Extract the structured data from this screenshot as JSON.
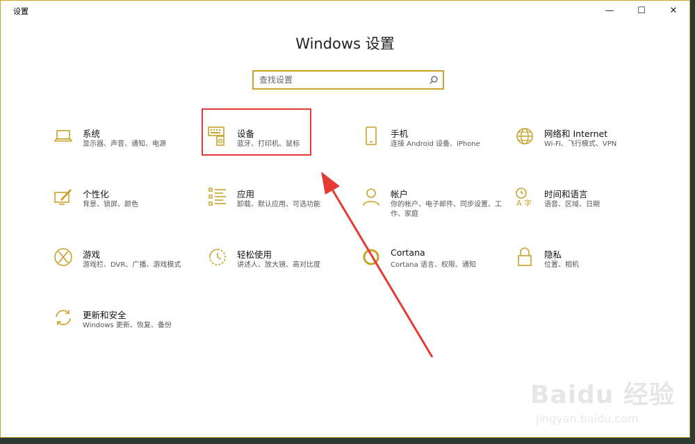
{
  "window": {
    "title": "设置",
    "controls": {
      "minimize": "—",
      "maximize": "☐",
      "close": "✕"
    }
  },
  "page_title": "Windows 设置",
  "search": {
    "placeholder": "查找设置",
    "icon": "search-icon"
  },
  "categories": [
    {
      "name": "系统",
      "desc": "显示器、声音、通知、电源",
      "icon": "laptop-icon"
    },
    {
      "name": "设备",
      "desc": "蓝牙、打印机、鼠标",
      "icon": "devices-icon"
    },
    {
      "name": "手机",
      "desc": "连接 Android 设备、iPhone",
      "icon": "phone-icon"
    },
    {
      "name": "网络和 Internet",
      "desc": "Wi-Fi、飞行模式、VPN",
      "icon": "globe-icon"
    },
    {
      "name": "个性化",
      "desc": "背景、锁屏、颜色",
      "icon": "personalization-icon"
    },
    {
      "name": "应用",
      "desc": "卸载、默认应用、可选功能",
      "icon": "apps-list-icon"
    },
    {
      "name": "帐户",
      "desc": "你的帐户、电子邮件、同步设置、工作、家庭",
      "icon": "person-icon"
    },
    {
      "name": "时间和语言",
      "desc": "语音、区域、日期",
      "icon": "time-language-icon"
    },
    {
      "name": "游戏",
      "desc": "游戏栏、DVR、广播、游戏模式",
      "icon": "xbox-icon"
    },
    {
      "name": "轻松使用",
      "desc": "讲述人、放大镜、高对比度",
      "icon": "ease-of-access-icon"
    },
    {
      "name": "Cortana",
      "desc": "Cortana 语言、权限、通知",
      "icon": "cortana-icon"
    },
    {
      "name": "隐私",
      "desc": "位置、相机",
      "icon": "lock-icon"
    },
    {
      "name": "更新和安全",
      "desc": "Windows 更新、恢复、备份",
      "icon": "sync-icon"
    }
  ],
  "watermark": {
    "brand": "Baidu 经验",
    "url": "jingyan.baidu.com"
  },
  "colors": {
    "accent": "#c9a227",
    "highlight": "#e53935"
  }
}
